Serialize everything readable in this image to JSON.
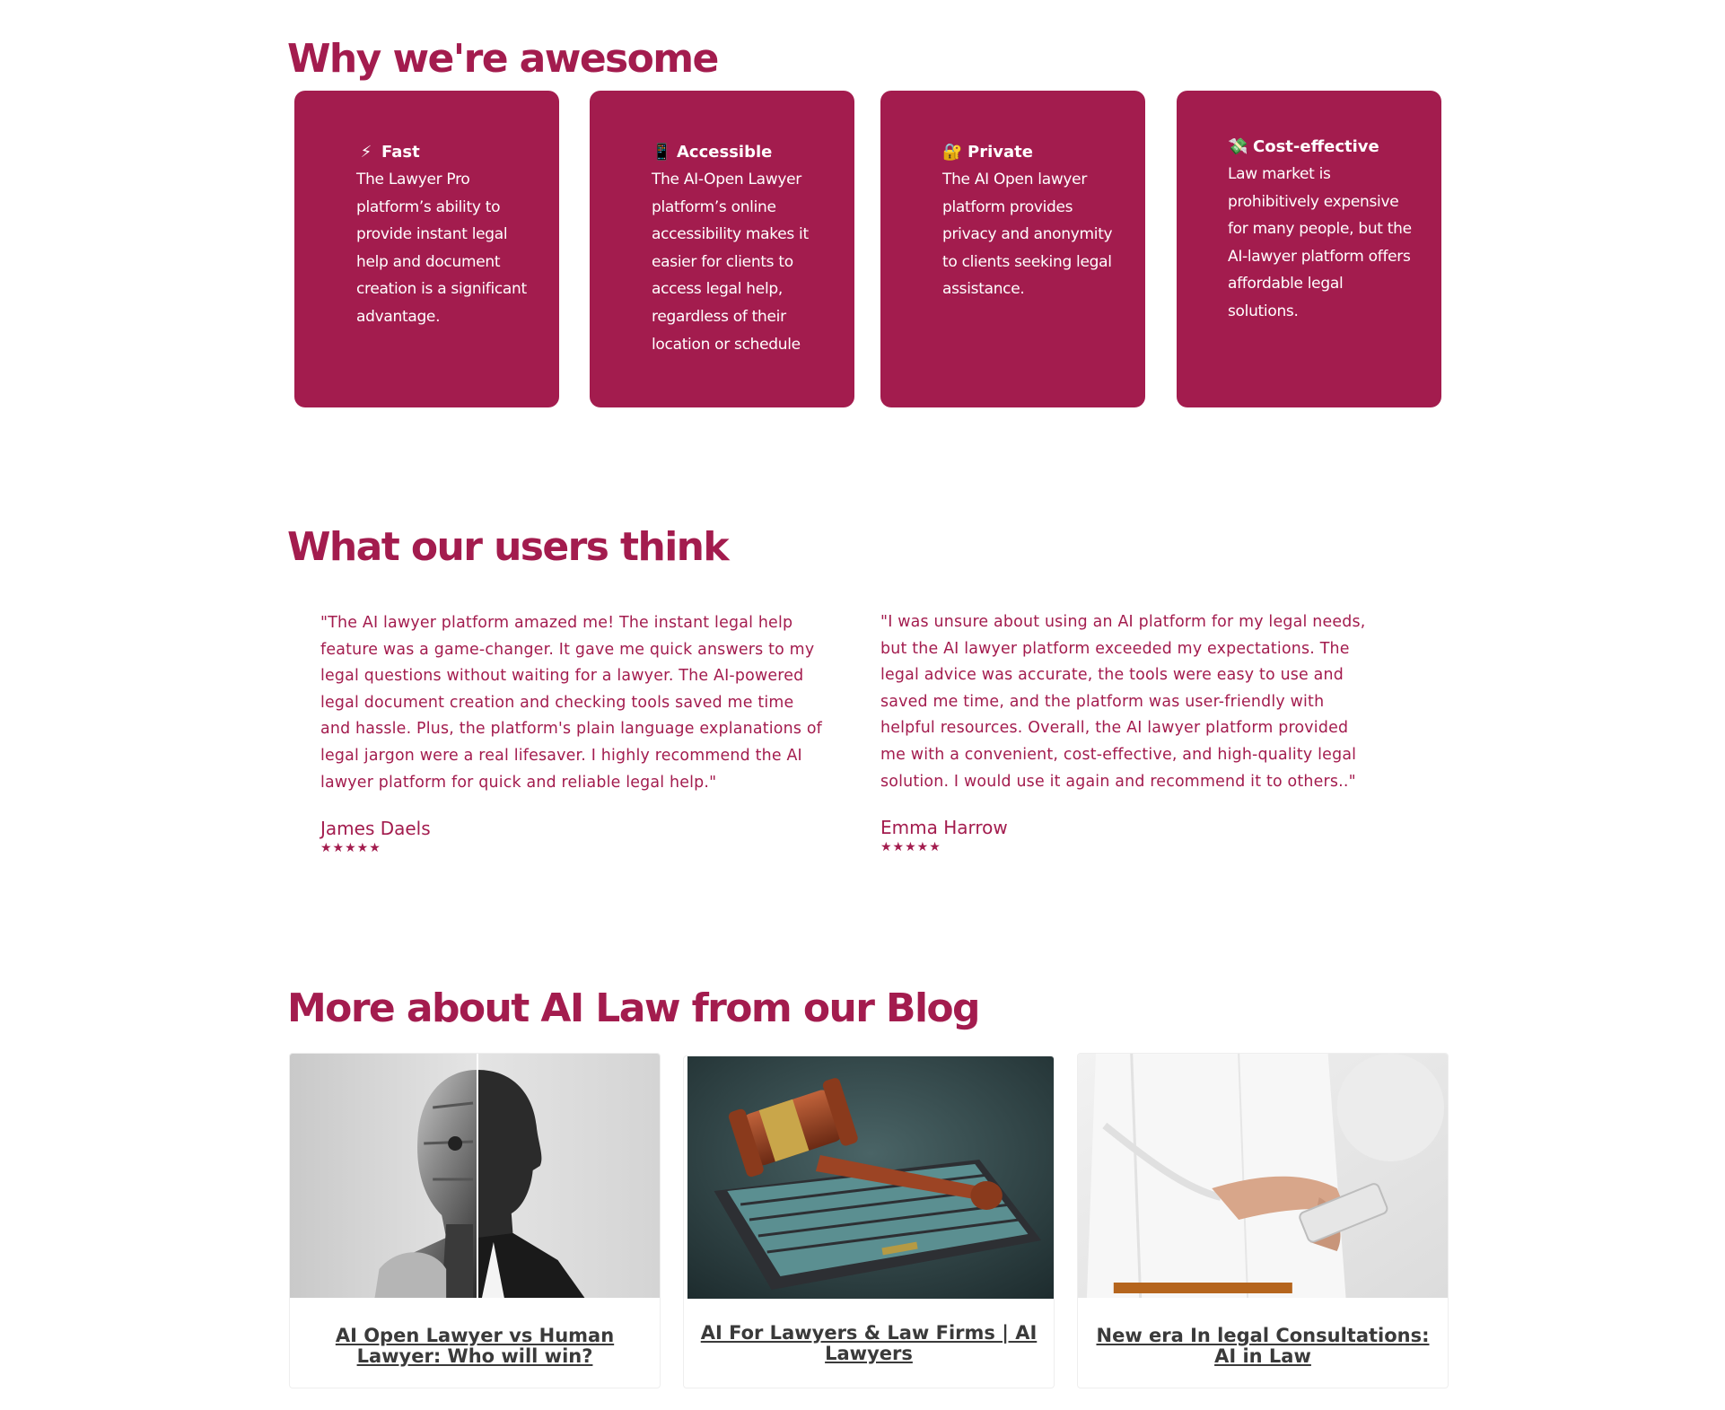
{
  "why": {
    "title": "Why we're awesome",
    "features": [
      {
        "icon": "lightning-icon",
        "emoji": "⚡",
        "title": "Fast",
        "text": "The Lawyer Pro platform’s ability to provide instant legal help and document creation is a significant advantage."
      },
      {
        "icon": "mobile-phone-icon",
        "emoji": "📱",
        "title": "Accessible",
        "text": "The AI-Open Lawyer platform’s online accessibility makes it easier for clients to access legal help, regardless of their location or schedule"
      },
      {
        "icon": "lock-icon",
        "emoji": "🔐",
        "title": "Private",
        "text": "The AI Open lawyer platform provides privacy and anonymity to clients seeking legal assistance."
      },
      {
        "icon": "money-wings-icon",
        "emoji": "💸",
        "title": "Cost-effective",
        "text": "Law market is prohibitively expensive for many people, but the AI-lawyer platform offers affordable legal solutions."
      }
    ]
  },
  "testimonials": {
    "title": "What our users think",
    "items": [
      {
        "quote": "\"The AI lawyer platform amazed me! The instant legal help feature was a game-changer. It gave me quick answers to my legal questions without waiting for a lawyer. The AI-powered legal document creation and checking tools saved me time and hassle. Plus, the platform's plain language explanations of legal jargon were a real lifesaver. I highly recommend the AI lawyer platform for quick and reliable legal help.\"",
        "name": "James Daels",
        "stars": "★★★★★"
      },
      {
        "quote": "\"I was unsure about using an AI platform for my legal needs, but the AI lawyer platform exceeded my expectations. The legal advice was accurate, the tools were easy to use and saved me time, and the platform was user-friendly with helpful resources. Overall, the AI lawyer platform provided me with a convenient, cost-effective, and high-quality legal solution. I would use it again and recommend it to others..\"",
        "name": "Emma Harrow",
        "stars": "★★★★★"
      }
    ]
  },
  "blog": {
    "title": "More about AI Law from our Blog",
    "posts": [
      {
        "title": "AI Open Lawyer vs Human Lawyer: Who will win?"
      },
      {
        "title": "AI For Lawyers & Law Firms | AI Lawyers"
      },
      {
        "title": "New era In legal Consultations: AI in Law"
      }
    ]
  },
  "colors": {
    "brand": "#a31c4e",
    "blog_title": "#3a3a3a"
  }
}
